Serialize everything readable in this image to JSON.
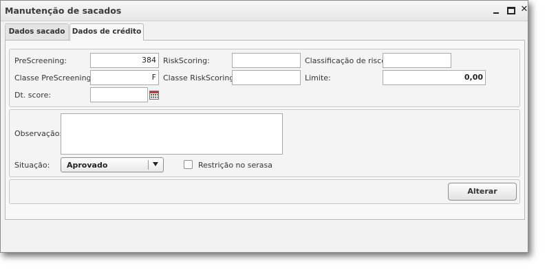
{
  "window": {
    "title": "Manutenção de sacados"
  },
  "tabs": [
    {
      "label": "Dados sacado",
      "active": false
    },
    {
      "label": "Dados de crédito",
      "active": true
    }
  ],
  "credit": {
    "prescreening": {
      "label": "PreScreening:",
      "value": "384"
    },
    "riskscoring": {
      "label": "RiskScoring:",
      "value": ""
    },
    "classificacao_risco": {
      "label": "Classificação de risco:",
      "value": ""
    },
    "classe_prescreening": {
      "label": "Classe PreScreening:",
      "value": "F"
    },
    "classe_riskscoring": {
      "label": "Classe RiskScoring:",
      "value": ""
    },
    "limite": {
      "label": "Limite:",
      "value": "0,00"
    },
    "dt_score": {
      "label": "Dt. score:",
      "value": ""
    }
  },
  "obs": {
    "observacao": {
      "label": "Observação:",
      "value": ""
    },
    "situacao": {
      "label": "Situação:",
      "selected": "Aprovado"
    },
    "restricao": {
      "label": "Restrição no serasa",
      "checked": false
    }
  },
  "actions": {
    "alterar": "Alterar"
  }
}
